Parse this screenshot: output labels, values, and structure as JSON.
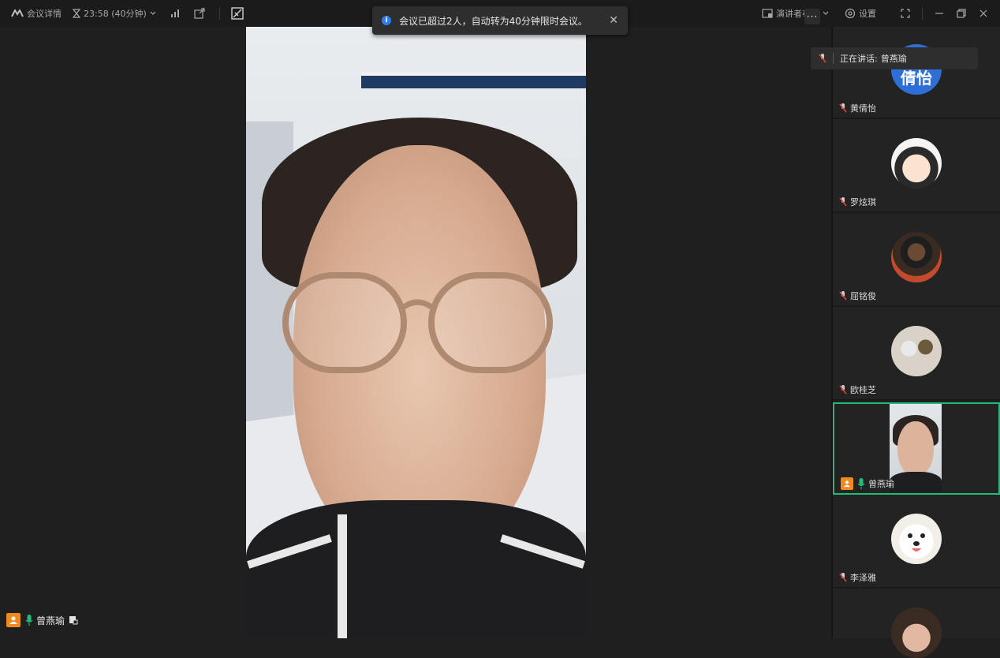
{
  "topbar": {
    "meeting_details": "会议详情",
    "timer": "23:58 (40分钟)",
    "layout_label": "演讲者布局",
    "settings_label": "设置"
  },
  "notice": {
    "text": "会议已超过2人，自动转为40分钟限时会议。"
  },
  "speaking": {
    "label": "正在讲话:",
    "name": "曾燕瑜"
  },
  "main": {
    "self_name": "曾燕瑜"
  },
  "avatar_initials": {
    "p1": "倩怡"
  },
  "participants": [
    {
      "name": "黄倩怡",
      "muted": true
    },
    {
      "name": "罗炫琪",
      "muted": true
    },
    {
      "name": "屈铭俊",
      "muted": true
    },
    {
      "name": "欧桂芝",
      "muted": true
    },
    {
      "name": "曾燕瑜",
      "muted": false,
      "active": true
    },
    {
      "name": "李泽雅",
      "muted": true
    },
    {
      "name": "",
      "muted": true
    }
  ],
  "colors": {
    "accent_green": "#1fbd7a",
    "info_blue": "#2f7cf6",
    "self_orange": "#f08a1c"
  }
}
